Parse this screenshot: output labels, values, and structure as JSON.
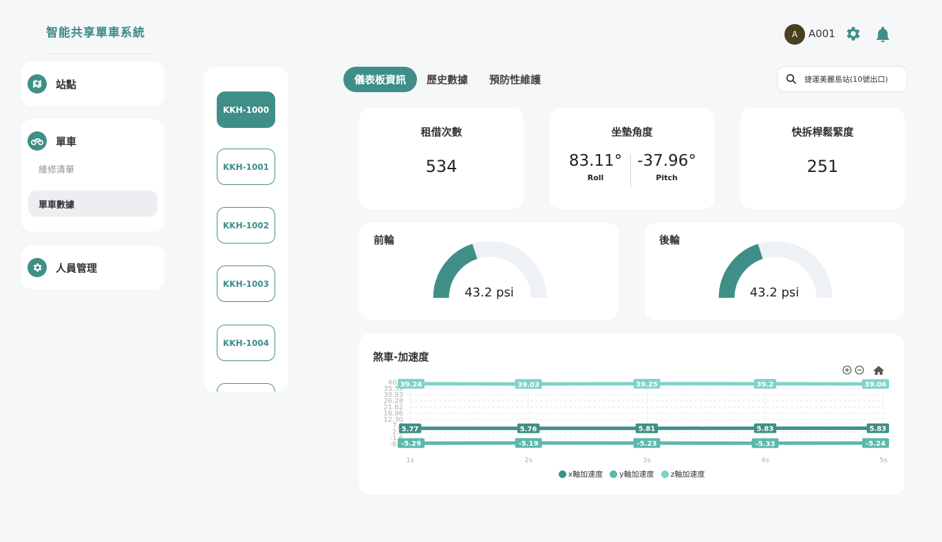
{
  "app": {
    "title": "智能共享單車系統"
  },
  "header": {
    "avatar_initial": "A",
    "user_id": "A001"
  },
  "sidebar": {
    "stations": {
      "label": "站點"
    },
    "bikes": {
      "label": "單車",
      "items": [
        {
          "label": "維修清單"
        },
        {
          "label": "單車數據"
        }
      ]
    },
    "staff": {
      "label": "人員管理"
    }
  },
  "bike_list": [
    "KKH-1000",
    "KKH-1001",
    "KKH-1002",
    "KKH-1003",
    "KKH-1004"
  ],
  "tabs": [
    {
      "label": "儀表板資訊"
    },
    {
      "label": "歷史數據"
    },
    {
      "label": "預防性維護"
    }
  ],
  "search": {
    "value": "捷運美麗島站(10號出口)"
  },
  "stats": {
    "rentals": {
      "title": "租借次數",
      "value": "534"
    },
    "seat": {
      "title": "坐墊角度",
      "roll_value": "83.11°",
      "roll_label": "Roll",
      "pitch_value": "-37.96°",
      "pitch_label": "Pitch"
    },
    "quick_release": {
      "title": "快拆桿鬆緊度",
      "value": "251"
    }
  },
  "gauges": {
    "front": {
      "title": "前輪",
      "value_text": "43.2 psi",
      "fraction": 0.4
    },
    "rear": {
      "title": "後輪",
      "value_text": "43.2 psi",
      "fraction": 0.4
    }
  },
  "colors": {
    "accent": "#3f8f88",
    "gauge_track": "#eef1f5",
    "series_x": "#3f8f88",
    "series_y": "#5cb8ac",
    "series_z": "#7fd3c9"
  },
  "chart_data": {
    "type": "line",
    "title": "煞車-加速度",
    "x": [
      "1s",
      "2s",
      "3s",
      "4s",
      "5s"
    ],
    "y_ticks": [
      "40.2",
      "35.59",
      "30.93",
      "26.28",
      "21.62",
      "16.96",
      "12.30",
      "7.6",
      "2.9",
      "-1.6",
      "-6.2"
    ],
    "ylim": [
      -6.2,
      40.2
    ],
    "series": [
      {
        "name": "x軸加速度",
        "values": [
          5.77,
          5.76,
          5.81,
          5.83,
          5.83
        ],
        "labels": [
          "5.77",
          "5.76",
          "5.81",
          "5.83",
          "5.83"
        ]
      },
      {
        "name": "y軸加速度",
        "values": [
          -5.29,
          -5.19,
          -5.23,
          -5.33,
          -5.24
        ],
        "labels": [
          "-5.29",
          "-5.19",
          "-5.23",
          "-5.33",
          "-5.24"
        ]
      },
      {
        "name": "z軸加速度",
        "values": [
          39.24,
          39.03,
          39.25,
          39.2,
          39.06
        ],
        "labels": [
          "39.24",
          "39.03",
          "39.25",
          "39.2",
          "39.06"
        ]
      }
    ],
    "legend": "bottom",
    "grid": true
  }
}
